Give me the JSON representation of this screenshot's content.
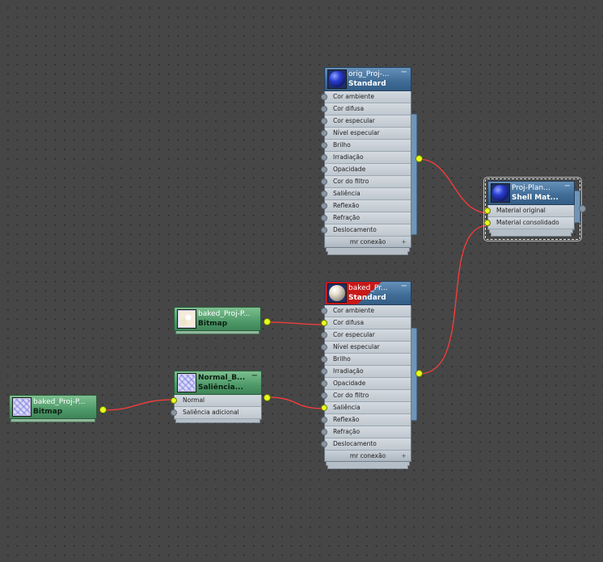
{
  "nodes": {
    "orig_standard": {
      "name": "orig_Proj-...",
      "type": "Standard",
      "slots": [
        "Cor ambiente",
        "Cor difusa",
        "Cor especular",
        "Nível especular",
        "Brilho",
        "Irradiação",
        "Opacidade",
        "Cor do filtro",
        "Saliência",
        "Reflexão",
        "Refração",
        "Deslocamento"
      ],
      "footer": "mr conexão",
      "collapse": "−",
      "expand": "+"
    },
    "shell": {
      "name": "Proj-Plan...",
      "type": "Shell Mat...",
      "slots": [
        "Material original",
        "Material consolidado"
      ],
      "collapse": "−"
    },
    "baked_standard": {
      "name": "baked_Pr...",
      "type": "Standard",
      "slots": [
        "Cor ambiente",
        "Cor difusa",
        "Cor especular",
        "Nível especular",
        "Brilho",
        "Irradiação",
        "Opacidade",
        "Cor do filtro",
        "Saliência",
        "Reflexão",
        "Refração",
        "Deslocamento"
      ],
      "footer": "mr conexão",
      "collapse": "−",
      "expand": "+"
    },
    "bitmap_diffuse": {
      "name": "baked_Proj-P...",
      "type": "Bitmap"
    },
    "normal_bump": {
      "name": "Normal_B...",
      "type": "Saliência...",
      "slots": [
        "Normal",
        "Saliência adicional"
      ],
      "collapse": "−"
    },
    "bitmap_normal": {
      "name": "baked_Proj-P...",
      "type": "Bitmap"
    }
  },
  "colors": {
    "background": "#464646",
    "wire": "#ff3b3b",
    "socket_active": "#e6ff1e",
    "material_header": "#3f6c96",
    "map_header": "#4f9a69",
    "baked_flag": "#c81818"
  }
}
